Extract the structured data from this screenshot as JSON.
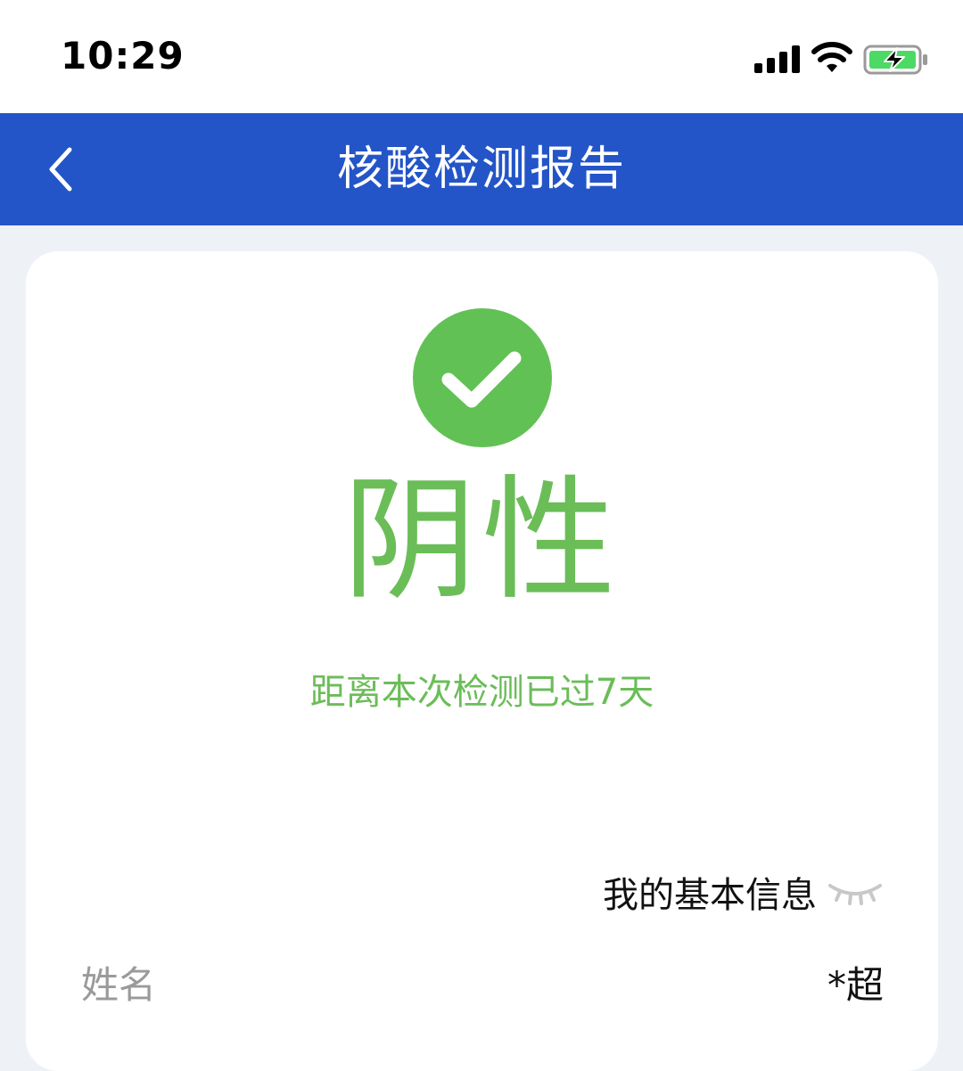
{
  "status_bar": {
    "time": "10:29",
    "icons": [
      "signal-icon",
      "wifi-icon",
      "battery-charging-icon"
    ]
  },
  "nav": {
    "back_icon": "chevron-left-icon",
    "title": "核酸检测报告"
  },
  "result": {
    "icon": "check-circle-icon",
    "status": "阴性",
    "elapsed": "距离本次检测已过7天"
  },
  "info": {
    "title": "我的基本信息",
    "toggle_icon": "eye-closed-icon",
    "rows": [
      {
        "label": "姓名",
        "value": "*超"
      }
    ]
  },
  "colors": {
    "nav_bg": "#2355c8",
    "negative_green": "#6bbd58",
    "page_bg": "#eef2f6"
  }
}
